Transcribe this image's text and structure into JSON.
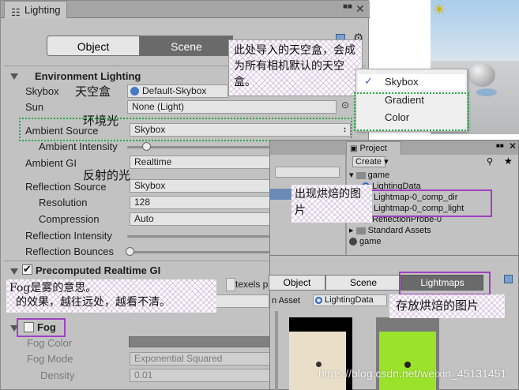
{
  "window": {
    "title": "Lighting"
  },
  "mode_tabs": [
    "Object",
    "Scene"
  ],
  "environment": {
    "header": "Environment Lighting",
    "skybox_label": "Skybox",
    "skybox_value": "Default-Skybox",
    "sun_label": "Sun",
    "sun_value": "None (Light)",
    "ambient_source_label": "Ambient Source",
    "ambient_source_value": "Skybox",
    "ambient_intensity_label": "Ambient Intensity",
    "ambient_intensity_level": 0.14,
    "ambient_gi_label": "Ambient GI",
    "ambient_gi_value": "Realtime",
    "reflection_source_label": "Reflection Source",
    "reflection_source_value": "Skybox",
    "resolution_label": "Resolution",
    "resolution_value": "128",
    "compression_label": "Compression",
    "compression_value": "Auto",
    "reflection_intensity_label": "Reflection Intensity",
    "reflection_bounces_label": "Reflection Bounces"
  },
  "precomputed": {
    "header": "Precomputed Realtime GI",
    "checked": true,
    "texels_label": "texels p"
  },
  "fog": {
    "header": "Fog",
    "checked": false,
    "color_label": "Fog Color",
    "mode_label": "Fog Mode",
    "mode_value": "Exponential Squared",
    "density_label": "Density",
    "density_value": "0.01"
  },
  "dropdown": {
    "items": [
      "Skybox",
      "Gradient",
      "Color"
    ],
    "selected": "Skybox"
  },
  "project": {
    "tab": "Project",
    "create_label": "Create",
    "partial_label": "ght",
    "tree": [
      {
        "label": "game",
        "type": "folder",
        "indent": 0
      },
      {
        "label": "LightingData",
        "type": "lighting",
        "indent": 1
      },
      {
        "label": "Lightmap-0_comp_dir",
        "type": "lightmap-dir",
        "indent": 1
      },
      {
        "label": "Lightmap-0_comp_light",
        "type": "lightmap-light",
        "indent": 1
      },
      {
        "label": "ReflectionProbe-0",
        "type": "probe",
        "indent": 1
      },
      {
        "label": "Standard Assets",
        "type": "folder",
        "indent": 0
      },
      {
        "label": "game",
        "type": "unity",
        "indent": 0
      }
    ]
  },
  "lightmaps_panel": {
    "tabs": [
      "Object",
      "Scene",
      "Lightmaps"
    ],
    "asset_label": "n Asset",
    "asset_value": "LightingData"
  },
  "annotations": {
    "skybox_note": "此处导入的天空盒，会成为所有相机默认的天空盒。",
    "skybox_cn": "天空盒",
    "ambient_cn": "环境光",
    "reflection_cn": "反射的光",
    "baked_cn": "出现烘焙的图片",
    "fog_note_line1": "Fog是雾的意思。",
    "fog_note_line2": "的效果，越往远处，越看不清。",
    "store_cn": "存放烘焙的图片"
  },
  "watermark": "https://blog.csdn.net/weixin_45131451",
  "colors": {
    "frame": "#c2c2c2",
    "selected_tab": "#6a6a6a",
    "highlight_purple": "#a040c0",
    "dotted_green": "#2aa84a",
    "sky_blue": "#9cc4e8",
    "lightmap_green": "#9be22a"
  }
}
